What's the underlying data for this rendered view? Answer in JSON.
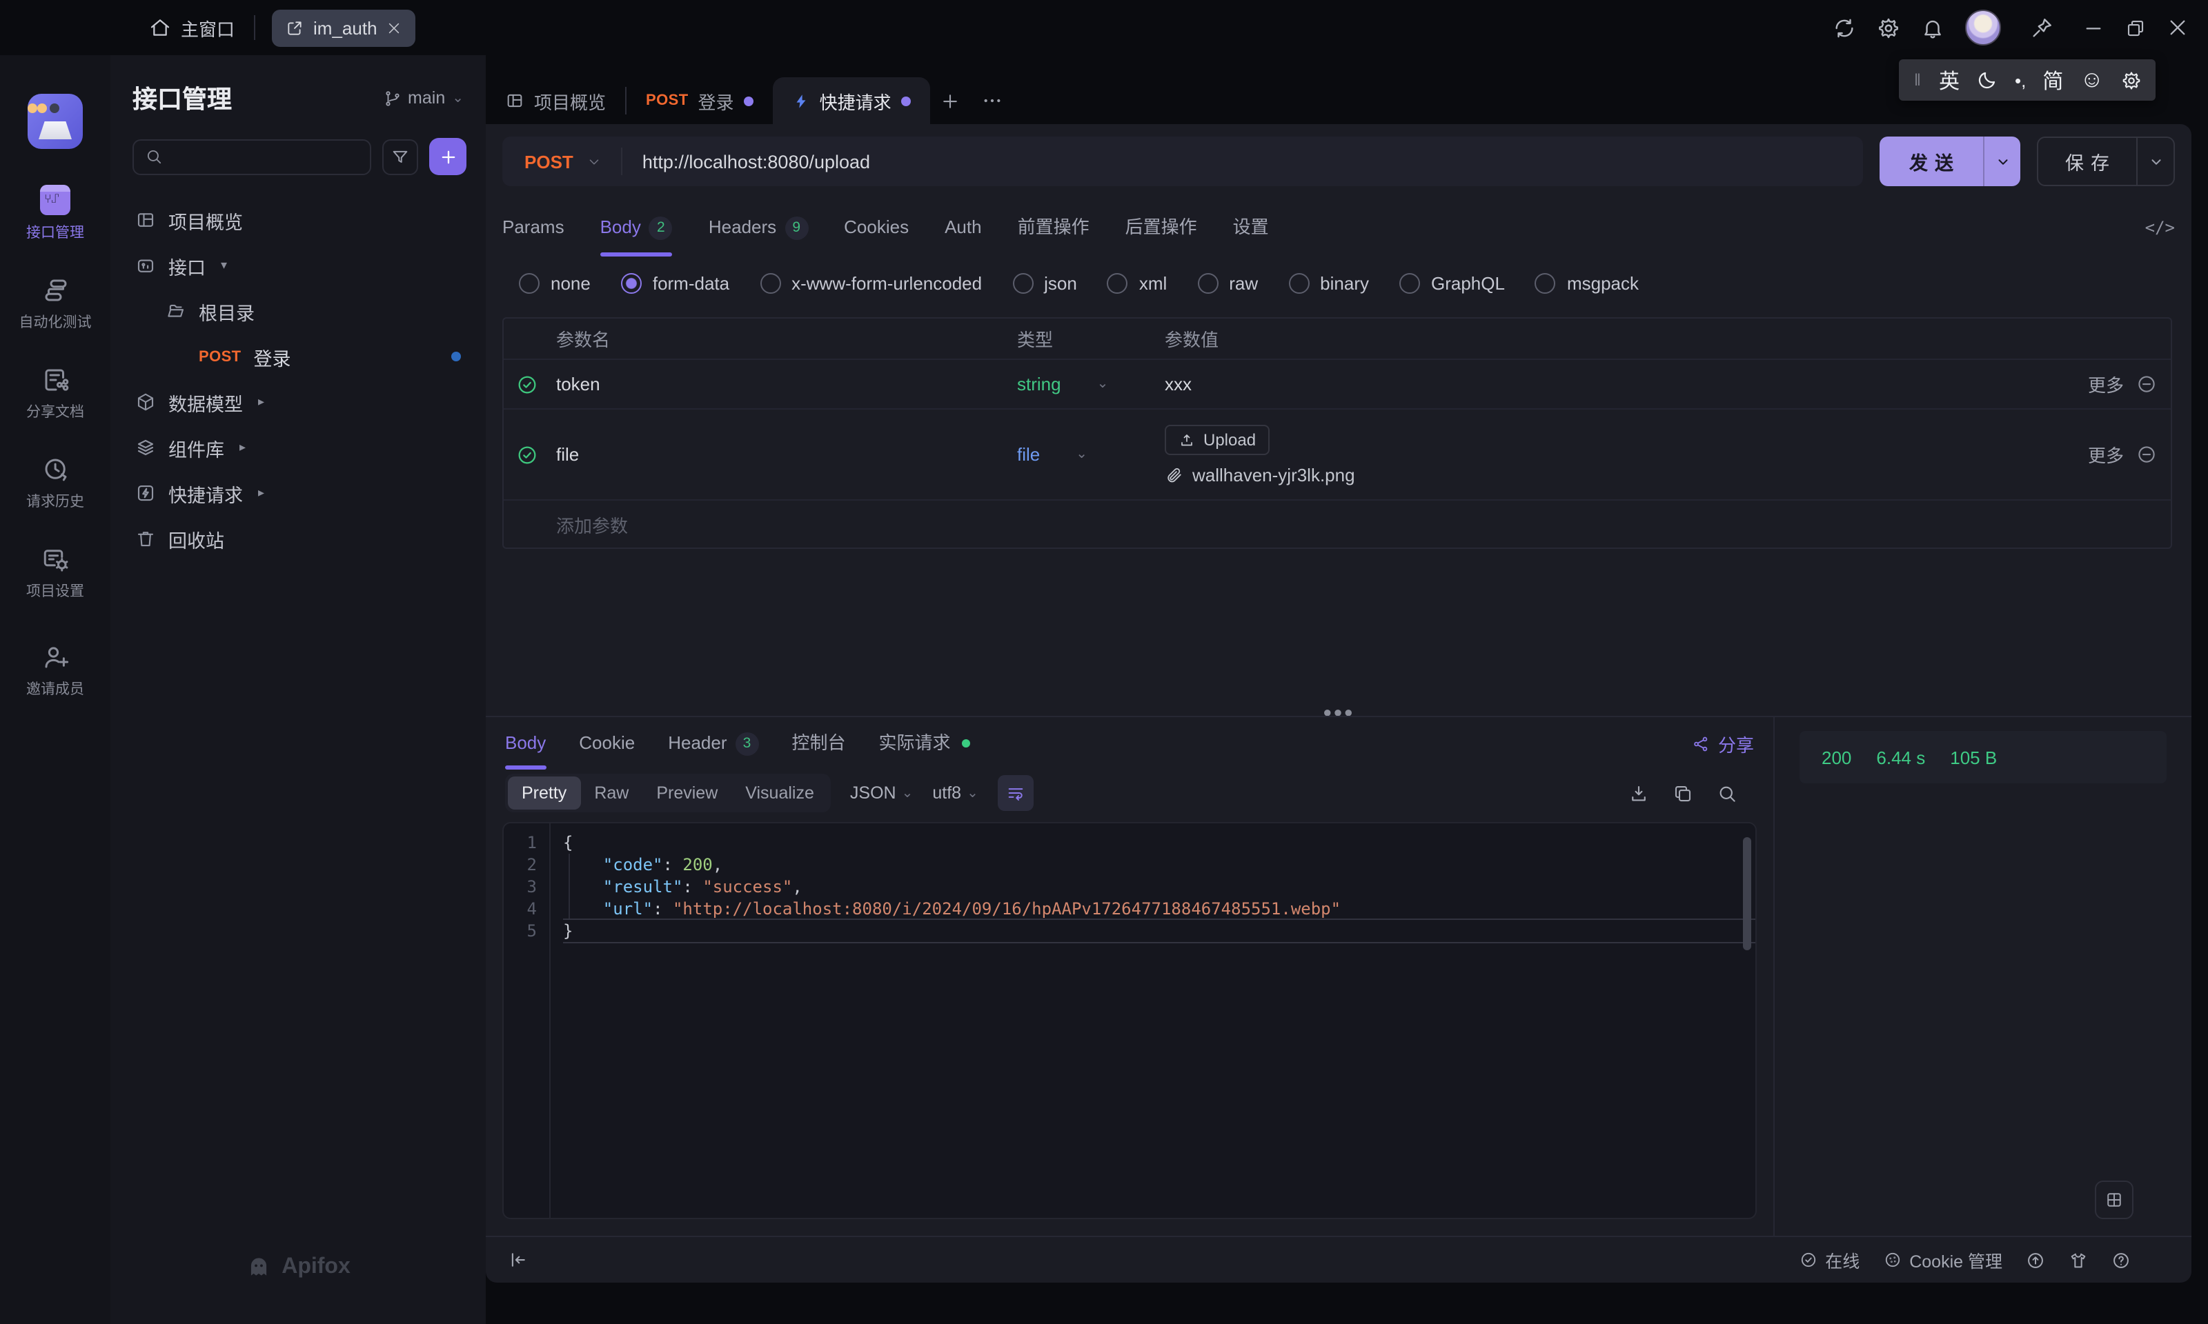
{
  "titlebar": {
    "home": "主窗口",
    "workspace_tab": "im_auth"
  },
  "ime": {
    "handle": "‖",
    "lang": "英",
    "punct": "•,",
    "charset": "简",
    "emoji": "☺"
  },
  "rail": [
    {
      "label": "接口管理"
    },
    {
      "label": "自动化测试"
    },
    {
      "label": "分享文档"
    },
    {
      "label": "请求历史"
    },
    {
      "label": "项目设置"
    },
    {
      "label": "邀请成员"
    }
  ],
  "sidebar": {
    "title": "接口管理",
    "branch": "main",
    "logo": "Apifox",
    "tree": [
      {
        "label": "项目概览"
      },
      {
        "label": "接口"
      },
      {
        "label": "根目录"
      },
      {
        "method": "POST",
        "label": "登录"
      },
      {
        "label": "数据模型"
      },
      {
        "label": "组件库"
      },
      {
        "label": "快捷请求"
      },
      {
        "label": "回收站"
      }
    ]
  },
  "doc_tabs": [
    {
      "label": "项目概览"
    },
    {
      "method": "POST",
      "label": "登录"
    },
    {
      "label": "快捷请求"
    }
  ],
  "request": {
    "method": "POST",
    "url": "http://localhost:8080/upload",
    "send_label": "发送",
    "save_label": "保存"
  },
  "request_tabs": [
    {
      "label": "Params"
    },
    {
      "label": "Body",
      "badge": "2"
    },
    {
      "label": "Headers",
      "badge": "9"
    },
    {
      "label": "Cookies"
    },
    {
      "label": "Auth"
    },
    {
      "label": "前置操作"
    },
    {
      "label": "后置操作"
    },
    {
      "label": "设置"
    }
  ],
  "body_types": {
    "selected": "form-data",
    "options": [
      "none",
      "form-data",
      "x-www-form-urlencoded",
      "json",
      "xml",
      "raw",
      "binary",
      "GraphQL",
      "msgpack"
    ]
  },
  "params": {
    "col_name": "参数名",
    "col_type": "类型",
    "col_value": "参数值",
    "rows": [
      {
        "name": "token",
        "type": "string",
        "value": "xxx",
        "more": "更多"
      },
      {
        "name": "file",
        "type": "file",
        "upload_label": "Upload",
        "filename": "wallhaven-yjr3lk.png",
        "more": "更多"
      }
    ],
    "add_label": "添加参数"
  },
  "response": {
    "tabs": [
      {
        "label": "Body"
      },
      {
        "label": "Cookie"
      },
      {
        "label": "Header",
        "badge": "3"
      },
      {
        "label": "控制台"
      },
      {
        "label": "实际请求"
      }
    ],
    "share_label": "分享",
    "status": {
      "code": "200",
      "time": "6.44 s",
      "size": "105 B"
    },
    "modes": [
      "Pretty",
      "Raw",
      "Preview",
      "Visualize"
    ],
    "format": "JSON",
    "encoding": "utf8",
    "body_lines": [
      {
        "n": 1,
        "segs": [
          {
            "c": "p",
            "t": "{"
          }
        ]
      },
      {
        "n": 2,
        "segs": [
          {
            "c": "k",
            "t": "    \"code\""
          },
          {
            "c": "p",
            "t": ": "
          },
          {
            "c": "n",
            "t": "200"
          },
          {
            "c": "p",
            "t": ","
          }
        ]
      },
      {
        "n": 3,
        "segs": [
          {
            "c": "k",
            "t": "    \"result\""
          },
          {
            "c": "p",
            "t": ": "
          },
          {
            "c": "s",
            "t": "\"success\""
          },
          {
            "c": "p",
            "t": ","
          }
        ]
      },
      {
        "n": 4,
        "segs": [
          {
            "c": "k",
            "t": "    \"url\""
          },
          {
            "c": "p",
            "t": ": "
          },
          {
            "c": "u",
            "t": "\"http://localhost:8080/i/2024/09/16/hpAAPv1726477188467485551.webp\""
          }
        ]
      },
      {
        "n": 5,
        "current": true,
        "segs": [
          {
            "c": "p",
            "t": "}"
          }
        ]
      }
    ]
  },
  "footer": {
    "online": "在线",
    "cookie_label": "Cookie 管理"
  }
}
